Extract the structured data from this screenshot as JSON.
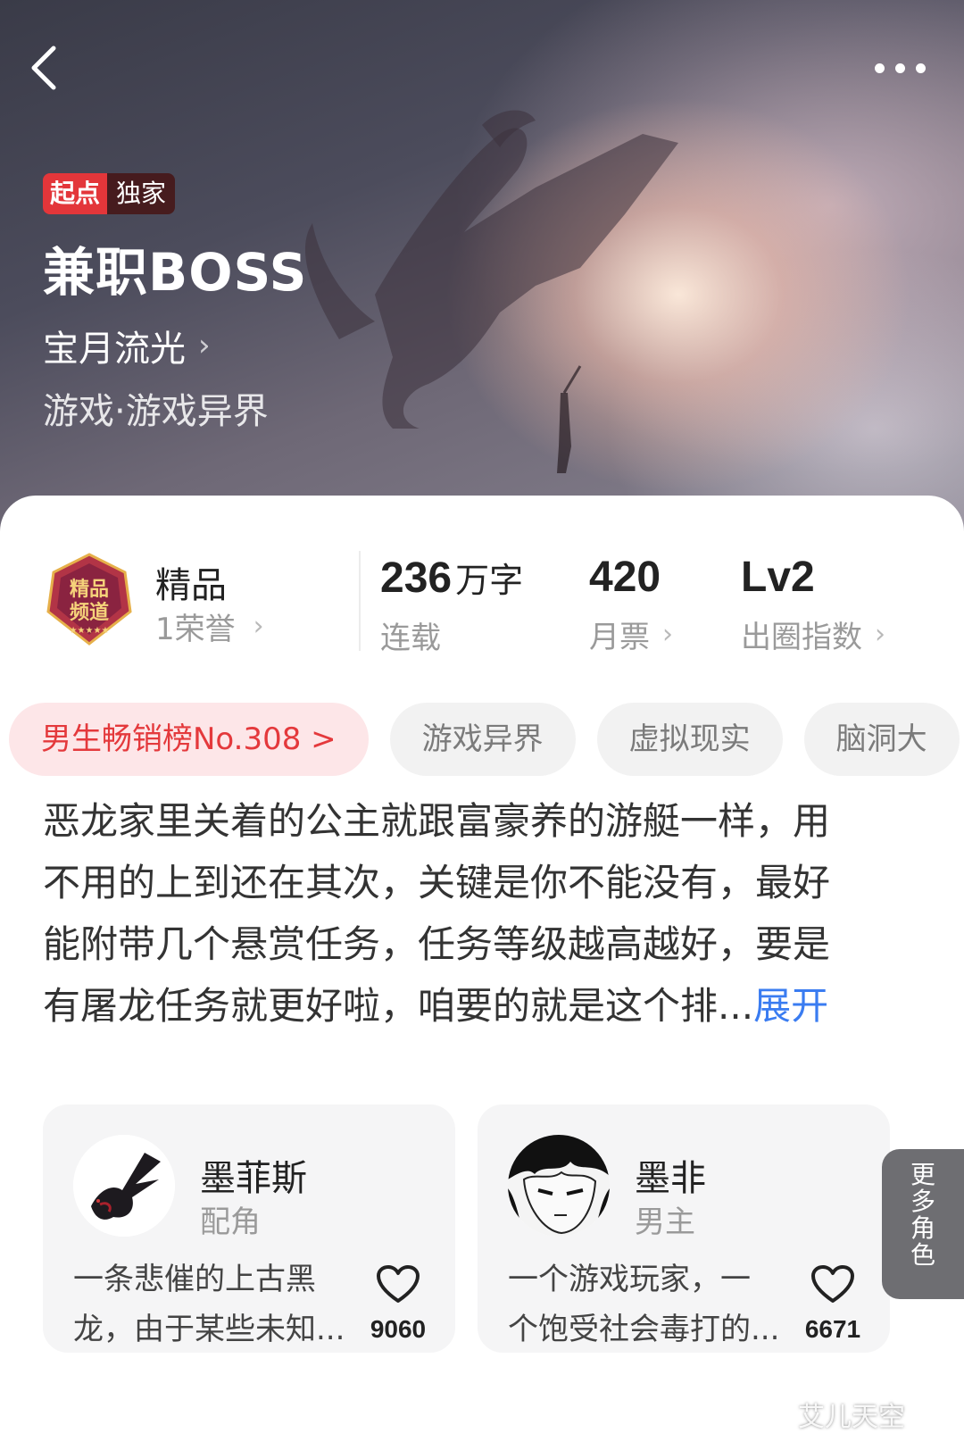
{
  "header": {
    "back_icon": "chevron-left-icon",
    "more_icon": "more-dots-icon"
  },
  "book": {
    "badge_brand": "起点",
    "badge_exclusive": "独家",
    "title": "兼职BOSS",
    "author": "宝月流光",
    "genre": "游戏·游戏异界"
  },
  "stats": {
    "quality_label": "精品",
    "honor": "1荣誉",
    "medal_text": "精品频道",
    "words_value": "236",
    "words_unit": "万字",
    "words_label": "连载",
    "tickets_value": "420",
    "tickets_label": "月票",
    "index_value": "Lv2",
    "index_label": "出圈指数"
  },
  "tags": [
    "男生畅销榜No.308 >",
    "游戏异界",
    "虚拟现实",
    "脑洞大"
  ],
  "intro": {
    "lines": [
      "恶龙家里关着的公主就跟富豪养的游艇一样，用",
      "不用的上到还在其次，关键是你不能没有，最好",
      "能附带几个悬赏任务，任务等级越高越好，要是",
      "有屠龙任务就更好啦，咱要的就是这个排..."
    ],
    "expand": "展开"
  },
  "characters": [
    {
      "name": "墨菲斯",
      "role": "配角",
      "desc_line1": "一条悲催的上古黑",
      "desc_line2": "龙，由于某些未知...",
      "likes": "9060"
    },
    {
      "name": "墨非",
      "role": "男主",
      "desc_line1": "一个游戏玩家，一",
      "desc_line2": "个饱受社会毒打的...",
      "likes": "6671"
    }
  ],
  "more_roles": [
    "更",
    "多",
    "角",
    "色"
  ],
  "watermark": "艾儿天空",
  "colors": {
    "accent_red": "#e4393c",
    "link_blue": "#3a7cf1",
    "tag_bg": "#f2f2f2"
  }
}
